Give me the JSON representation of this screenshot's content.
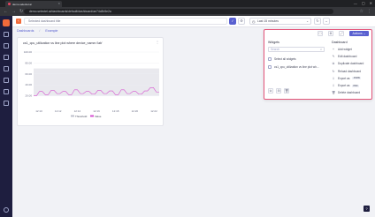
{
  "browser": {
    "tab_title": "demo.selectel.ai",
    "tab_close": "✕",
    "window_controls": [
      "—",
      "▢",
      "✕"
    ],
    "nav": [
      "←",
      "→",
      "↻"
    ],
    "url": "demo.selectel.ai/dashboards/default/dashboard/ae74c8b5e2a",
    "right_icons": [
      "☆",
      "⋮"
    ]
  },
  "topbar": {
    "back_icon": "‹",
    "title_placeholder": "Selected dashboard title",
    "save_icon": "✓",
    "settings_icon": "⚙",
    "time_range": "Last 15 minutes",
    "time_icon": "◷",
    "time_chevron": "⌄",
    "refresh_icon": "↻",
    "more_icon": "⌄"
  },
  "breadcrumb": {
    "items": [
      "Dashboards",
      "Example"
    ],
    "separator": "/"
  },
  "panel": {
    "title": "cs1_cpu_utilization vs line plot where device_name='lab'",
    "menu_icon": "⋮"
  },
  "menu": {
    "header_icons": [
      "☐",
      "⚙",
      "⤢"
    ],
    "actions_label": "Actions ⌄",
    "widgets_heading": "Widgets",
    "search_placeholder": "Search",
    "search_icon": "⌕",
    "select_all_label": "Select all widgets",
    "widget_items": [
      "cs1_cpu_utilization vs line plot wh..."
    ],
    "widget_buttons": [
      "⧉",
      "⊞",
      "🗑"
    ],
    "dashboard_heading": "Dashboard",
    "dashboard_items": [
      {
        "icon": "+",
        "label": "Add widget",
        "code": ""
      },
      {
        "icon": "✎",
        "label": "Edit dashboard",
        "code": ""
      },
      {
        "icon": "⧉",
        "label": "Duplicate dashboard",
        "code": ""
      },
      {
        "icon": "↻",
        "label": "Reload dashboard",
        "code": ""
      },
      {
        "icon": "⇩",
        "label": "Export as",
        "code": "JSON"
      },
      {
        "icon": "⇩",
        "label": "Export as",
        "code": "PDF"
      },
      {
        "icon": "🗑",
        "label": "Delete dashboard",
        "code": ""
      }
    ]
  },
  "help_icon": "?",
  "colors": {
    "accent": "#5960d0",
    "brand": "#f26b3a",
    "sidebar": "#1e1e3f",
    "series": "#d64fd0",
    "threshold_band": "#e9e9ee",
    "menu_border": "#e4557a"
  },
  "chart_data": {
    "type": "line",
    "x_ticks": [
      "12:10",
      "12:12",
      "12:14",
      "12:16",
      "12:18",
      "12:20",
      "12:22"
    ],
    "y_ticks": [
      "100.00",
      "80.00",
      "60.00",
      "40.00",
      "20.00"
    ],
    "ylim": [
      0,
      100
    ],
    "legend": [
      "Threshold",
      "Value"
    ],
    "series": [
      {
        "name": "Value",
        "values": [
          20,
          20,
          28,
          28,
          22,
          22,
          30,
          30,
          24,
          24,
          28,
          28,
          22,
          22,
          31,
          31,
          24,
          24,
          28,
          28,
          23,
          23,
          30,
          30,
          24,
          24,
          29,
          29,
          22,
          22,
          31,
          31,
          24,
          24,
          28,
          28,
          23,
          23,
          29,
          29,
          35,
          35,
          27,
          27
        ]
      }
    ],
    "threshold_band": [
      20,
      70
    ]
  }
}
